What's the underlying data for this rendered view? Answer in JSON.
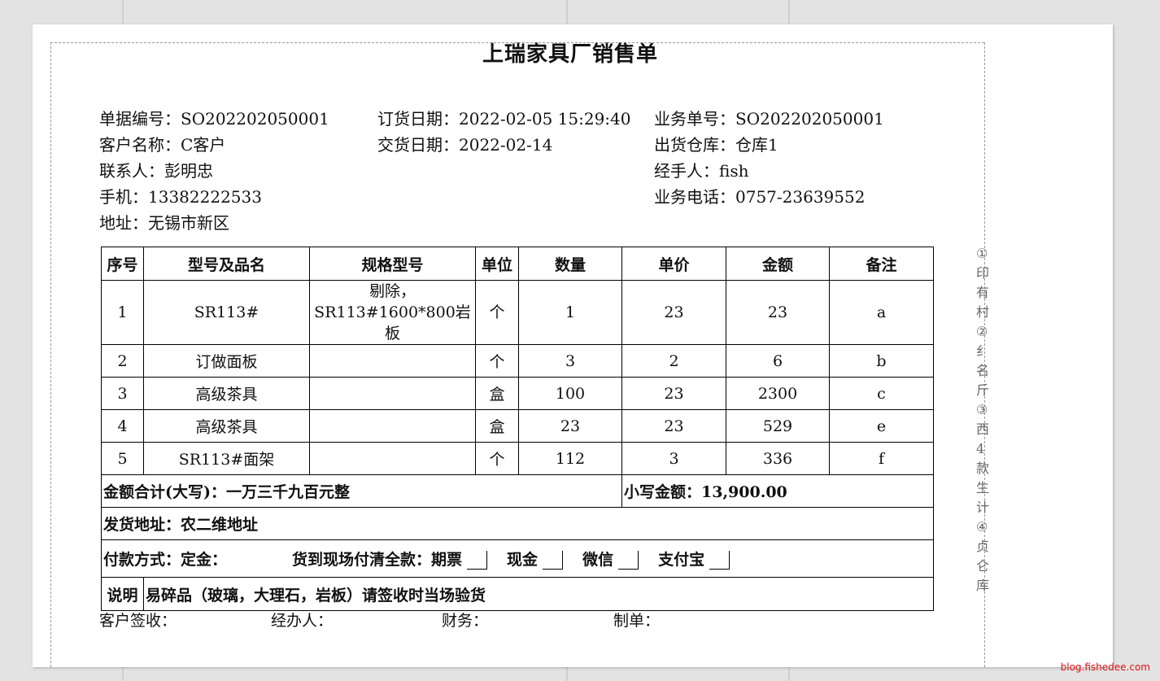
{
  "doc": {
    "title": "上瑞家具厂销售单",
    "info": {
      "bill_no": "单据编号：SO202202050001",
      "order_date": "订货日期：2022-02-05 15:29:40",
      "biz_no": "业务单号：SO202202050001",
      "customer": "客户名称：C客户",
      "delivery_date": "交货日期：2022-02-14",
      "warehouse": "出货仓库：仓库1",
      "contact": "联系人：彭明忠",
      "handler": "经手人：fish",
      "mobile": "手机：13382222533",
      "biz_phone": "业务电话：0757-23639552",
      "address": "地址：无锡市新区"
    },
    "table": {
      "headers": [
        "序号",
        "型号及品名",
        "规格型号",
        "单位",
        "数量",
        "单价",
        "金额",
        "备注"
      ],
      "rows": [
        {
          "no": "1",
          "name": "SR113#",
          "spec_l1": "剔除，",
          "spec_l2": "SR113#1600*800岩板",
          "unit": "个",
          "qty": "1",
          "price": "23",
          "amount": "23",
          "note": "a"
        },
        {
          "no": "2",
          "name": "订做面板",
          "spec_l1": "",
          "spec_l2": "",
          "unit": "个",
          "qty": "3",
          "price": "2",
          "amount": "6",
          "note": "b"
        },
        {
          "no": "3",
          "name": "高级茶具",
          "spec_l1": "",
          "spec_l2": "",
          "unit": "盒",
          "qty": "100",
          "price": "23",
          "amount": "2300",
          "note": "c"
        },
        {
          "no": "4",
          "name": "高级茶具",
          "spec_l1": "",
          "spec_l2": "",
          "unit": "盒",
          "qty": "23",
          "price": "23",
          "amount": "529",
          "note": "e"
        },
        {
          "no": "5",
          "name": "SR113#面架",
          "spec_l1": "",
          "spec_l2": "",
          "unit": "个",
          "qty": "112",
          "price": "3",
          "amount": "336",
          "note": "f"
        }
      ],
      "total_upper": "金额合计(大写)：一万三千九百元整",
      "total_lower": "小写金额：13,900.00",
      "ship_address": "发货地址：农二维地址",
      "pay_prefix": "付款方式：定金：",
      "pay_full": "货到现场付清全款：",
      "pay_options": [
        "期票",
        "现金",
        "微信",
        "支付宝"
      ],
      "note_label": "说明",
      "note_text": "易碎品（玻璃，大理石，岩板）请签收时当场验货"
    },
    "signatures": [
      "客户签收：",
      "经办人：",
      "财务：",
      "制单："
    ]
  },
  "side_glyphs": [
    "①",
    "印",
    "有",
    "村",
    "②",
    "纟",
    "名",
    "斤",
    "③",
    "西",
    "4",
    "款",
    "生",
    "计",
    "④",
    "贞",
    "仑",
    "库"
  ],
  "watermark": "blog.fishedee.com"
}
